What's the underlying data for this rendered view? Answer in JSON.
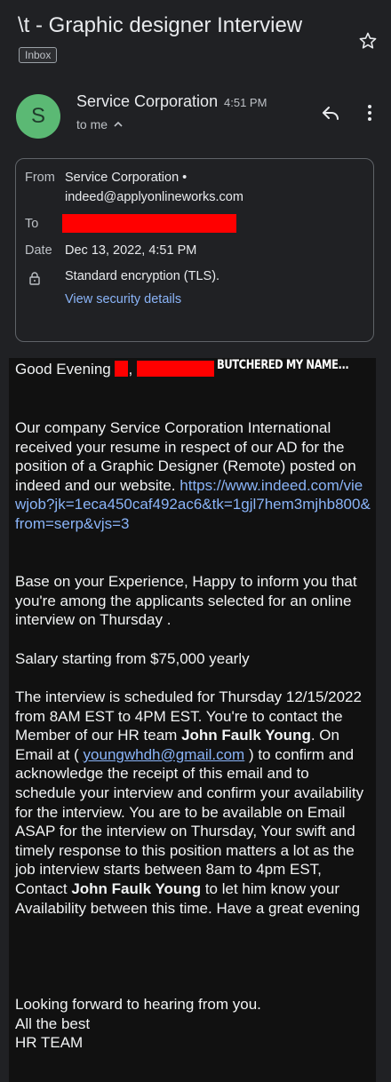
{
  "header": {
    "subject": "\\t - Graphic designer Interview",
    "label": "Inbox",
    "star_icon": "star-outline-icon"
  },
  "message": {
    "sender_initial": "S",
    "avatar_color": "#5bb974",
    "sender_name": "Service Corporation",
    "time": "4:51 PM",
    "to_me": "to me",
    "reply_icon": "reply-icon",
    "more_icon": "more-vert-icon"
  },
  "details": {
    "from_label": "From",
    "from_value": "Service Corporation • indeed@applyonlineworks.com",
    "to_label": "To",
    "date_label": "Date",
    "date_value": "Dec 13, 2022, 4:51 PM",
    "encryption": "Standard encryption (TLS).",
    "security_link": "View security details"
  },
  "body": {
    "greeting": "Good Evening",
    "annotation": "BUTCHERED MY NAME...",
    "p1_text": "Our company Service Corporation International received your resume in respect of our AD for the position of a Graphic Designer (Remote) posted on indeed and our website.",
    "p1_link": "https://www.indeed.com/viewjob?jk=1eca450caf492ac6&tk=1gjl7hem3mjhb800&from=serp&vjs=3",
    "p2": "Base on your Experience, Happy to inform you that you're among the applicants selected for an online interview on Thursday .",
    "p3": "Salary starting from $75,000 yearly",
    "p4_a": "The interview is scheduled for Thursday 12/15/2022 from 8AM EST to 4PM EST. You're to contact the Member of our HR team",
    "p4_name1": "John Faulk Young",
    "p4_b": ". On Email at (",
    "p4_email": "youngwhdh@gmail.com",
    "p4_c": ") to confirm and acknowledge the receipt of this email and to schedule your interview and confirm your availability for the interview. You are to be available on Email ASAP for the interview on Thursday, Your swift and timely response to this position matters a lot as the job interview starts between 8am to 4pm EST,",
    "p4_d": "Contact",
    "p4_name2": "John Faulk Young",
    "p4_e": "to let him know your Availability between this time. Have a great evening",
    "closing1": "Looking forward to hearing from you.",
    "closing2": "All the best",
    "closing3": "HR TEAM"
  }
}
